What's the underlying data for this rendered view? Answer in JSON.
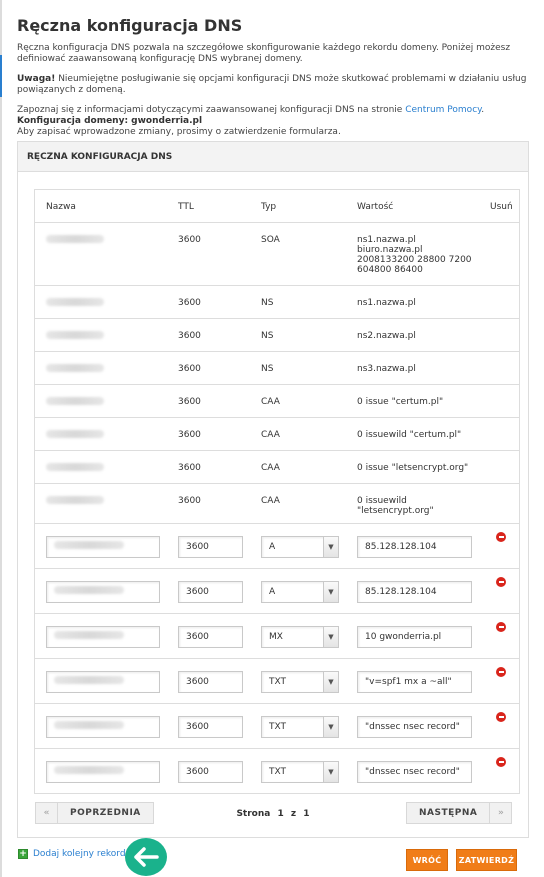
{
  "page": {
    "title": "Ręczna konfiguracja DNS",
    "intro": "Ręczna konfiguracja DNS pozwala na szczegółowe skonfigurowanie każdego rekordu domeny. Poniżej możesz definiować zaawansowaną konfigurację DNS wybranej domeny.",
    "warning_strong": "Uwaga!",
    "warning_text": " Nieumiejętne posługiwanie się opcjami konfiguracji DNS może skutkować problemami w działaniu usług powiązanych z domeną.",
    "info_text": "Zapoznaj się z informacjami dotyczącymi zaawansowanej konfiguracji DNS na stronie ",
    "info_link": "Centrum Pomocy",
    "info_link_after": ".",
    "domain_label": "Konfiguracja domeny: gwonderria.pl",
    "save_hint": "Aby zapisać wprowadzone zmiany, prosimy o zatwierdzenie formularza."
  },
  "panel": {
    "heading": "RĘCZNA KONFIGURACJA DNS",
    "columns": {
      "name": "Nazwa",
      "ttl": "TTL",
      "type": "Typ",
      "value": "Wartość",
      "delete": "Usuń"
    }
  },
  "static_records": [
    {
      "ttl": "3600",
      "type": "SOA",
      "value_lines": [
        "ns1.nazwa.pl",
        "biuro.nazwa.pl",
        "2008133200 28800 7200",
        "604800 86400"
      ]
    },
    {
      "ttl": "3600",
      "type": "NS",
      "value_lines": [
        "ns1.nazwa.pl"
      ]
    },
    {
      "ttl": "3600",
      "type": "NS",
      "value_lines": [
        "ns2.nazwa.pl"
      ]
    },
    {
      "ttl": "3600",
      "type": "NS",
      "value_lines": [
        "ns3.nazwa.pl"
      ]
    },
    {
      "ttl": "3600",
      "type": "CAA",
      "value_lines": [
        "0 issue \"certum.pl\""
      ]
    },
    {
      "ttl": "3600",
      "type": "CAA",
      "value_lines": [
        "0 issuewild \"certum.pl\""
      ]
    },
    {
      "ttl": "3600",
      "type": "CAA",
      "value_lines": [
        "0 issue \"letsencrypt.org\""
      ]
    },
    {
      "ttl": "3600",
      "type": "CAA",
      "value_lines": [
        "0 issuewild",
        "\"letsencrypt.org\""
      ]
    }
  ],
  "editable_records": [
    {
      "ttl": "3600",
      "type": "A",
      "value": "85.128.128.104"
    },
    {
      "ttl": "3600",
      "type": "A",
      "value": "85.128.128.104"
    },
    {
      "ttl": "3600",
      "type": "MX",
      "value": "10 gwonderria.pl"
    },
    {
      "ttl": "3600",
      "type": "TXT",
      "value": "\"v=spf1 mx a ~all\""
    },
    {
      "ttl": "3600",
      "type": "TXT",
      "value": "\"dnssec nsec record\""
    },
    {
      "ttl": "3600",
      "type": "TXT",
      "value": "\"dnssec nsec record\""
    }
  ],
  "pagination": {
    "prev_label": "POPRZEDNIA",
    "next_label": "NASTĘPNA",
    "prev_icon": "«",
    "next_icon": "»",
    "page_word": "Strona",
    "current": "1",
    "of_word": "z",
    "total": "1"
  },
  "actions": {
    "add_record": "Dodaj kolejny rekord",
    "back": "WRÓĆ",
    "confirm": "ZATWIERDŹ"
  },
  "colors": {
    "link": "#2a7fcf",
    "orange_button": "#f07d18",
    "delete_icon": "#d9251c",
    "add_icon": "#3aa53a",
    "arrow_badge": "#1ab28c"
  },
  "icons": {
    "delete": "minus-circle-icon",
    "add": "plus-square-icon",
    "select": "chevron-down-icon",
    "badge": "arrow-left-icon"
  }
}
